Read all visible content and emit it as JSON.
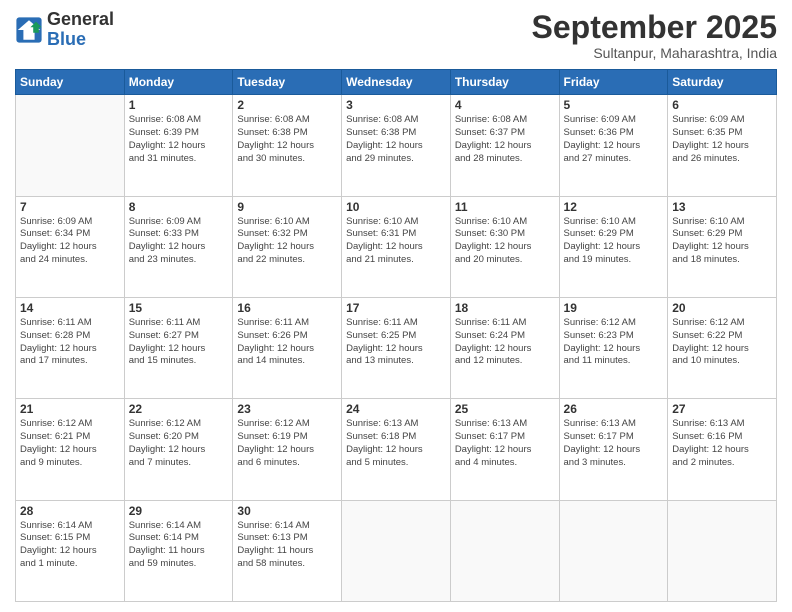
{
  "logo": {
    "line1": "General",
    "line2": "Blue"
  },
  "title": "September 2025",
  "subtitle": "Sultanpur, Maharashtra, India",
  "days_of_week": [
    "Sunday",
    "Monday",
    "Tuesday",
    "Wednesday",
    "Thursday",
    "Friday",
    "Saturday"
  ],
  "weeks": [
    [
      {
        "day": "",
        "info": ""
      },
      {
        "day": "1",
        "info": "Sunrise: 6:08 AM\nSunset: 6:39 PM\nDaylight: 12 hours\nand 31 minutes."
      },
      {
        "day": "2",
        "info": "Sunrise: 6:08 AM\nSunset: 6:38 PM\nDaylight: 12 hours\nand 30 minutes."
      },
      {
        "day": "3",
        "info": "Sunrise: 6:08 AM\nSunset: 6:38 PM\nDaylight: 12 hours\nand 29 minutes."
      },
      {
        "day": "4",
        "info": "Sunrise: 6:08 AM\nSunset: 6:37 PM\nDaylight: 12 hours\nand 28 minutes."
      },
      {
        "day": "5",
        "info": "Sunrise: 6:09 AM\nSunset: 6:36 PM\nDaylight: 12 hours\nand 27 minutes."
      },
      {
        "day": "6",
        "info": "Sunrise: 6:09 AM\nSunset: 6:35 PM\nDaylight: 12 hours\nand 26 minutes."
      }
    ],
    [
      {
        "day": "7",
        "info": "Sunrise: 6:09 AM\nSunset: 6:34 PM\nDaylight: 12 hours\nand 24 minutes."
      },
      {
        "day": "8",
        "info": "Sunrise: 6:09 AM\nSunset: 6:33 PM\nDaylight: 12 hours\nand 23 minutes."
      },
      {
        "day": "9",
        "info": "Sunrise: 6:10 AM\nSunset: 6:32 PM\nDaylight: 12 hours\nand 22 minutes."
      },
      {
        "day": "10",
        "info": "Sunrise: 6:10 AM\nSunset: 6:31 PM\nDaylight: 12 hours\nand 21 minutes."
      },
      {
        "day": "11",
        "info": "Sunrise: 6:10 AM\nSunset: 6:30 PM\nDaylight: 12 hours\nand 20 minutes."
      },
      {
        "day": "12",
        "info": "Sunrise: 6:10 AM\nSunset: 6:29 PM\nDaylight: 12 hours\nand 19 minutes."
      },
      {
        "day": "13",
        "info": "Sunrise: 6:10 AM\nSunset: 6:29 PM\nDaylight: 12 hours\nand 18 minutes."
      }
    ],
    [
      {
        "day": "14",
        "info": "Sunrise: 6:11 AM\nSunset: 6:28 PM\nDaylight: 12 hours\nand 17 minutes."
      },
      {
        "day": "15",
        "info": "Sunrise: 6:11 AM\nSunset: 6:27 PM\nDaylight: 12 hours\nand 15 minutes."
      },
      {
        "day": "16",
        "info": "Sunrise: 6:11 AM\nSunset: 6:26 PM\nDaylight: 12 hours\nand 14 minutes."
      },
      {
        "day": "17",
        "info": "Sunrise: 6:11 AM\nSunset: 6:25 PM\nDaylight: 12 hours\nand 13 minutes."
      },
      {
        "day": "18",
        "info": "Sunrise: 6:11 AM\nSunset: 6:24 PM\nDaylight: 12 hours\nand 12 minutes."
      },
      {
        "day": "19",
        "info": "Sunrise: 6:12 AM\nSunset: 6:23 PM\nDaylight: 12 hours\nand 11 minutes."
      },
      {
        "day": "20",
        "info": "Sunrise: 6:12 AM\nSunset: 6:22 PM\nDaylight: 12 hours\nand 10 minutes."
      }
    ],
    [
      {
        "day": "21",
        "info": "Sunrise: 6:12 AM\nSunset: 6:21 PM\nDaylight: 12 hours\nand 9 minutes."
      },
      {
        "day": "22",
        "info": "Sunrise: 6:12 AM\nSunset: 6:20 PM\nDaylight: 12 hours\nand 7 minutes."
      },
      {
        "day": "23",
        "info": "Sunrise: 6:12 AM\nSunset: 6:19 PM\nDaylight: 12 hours\nand 6 minutes."
      },
      {
        "day": "24",
        "info": "Sunrise: 6:13 AM\nSunset: 6:18 PM\nDaylight: 12 hours\nand 5 minutes."
      },
      {
        "day": "25",
        "info": "Sunrise: 6:13 AM\nSunset: 6:17 PM\nDaylight: 12 hours\nand 4 minutes."
      },
      {
        "day": "26",
        "info": "Sunrise: 6:13 AM\nSunset: 6:17 PM\nDaylight: 12 hours\nand 3 minutes."
      },
      {
        "day": "27",
        "info": "Sunrise: 6:13 AM\nSunset: 6:16 PM\nDaylight: 12 hours\nand 2 minutes."
      }
    ],
    [
      {
        "day": "28",
        "info": "Sunrise: 6:14 AM\nSunset: 6:15 PM\nDaylight: 12 hours\nand 1 minute."
      },
      {
        "day": "29",
        "info": "Sunrise: 6:14 AM\nSunset: 6:14 PM\nDaylight: 11 hours\nand 59 minutes."
      },
      {
        "day": "30",
        "info": "Sunrise: 6:14 AM\nSunset: 6:13 PM\nDaylight: 11 hours\nand 58 minutes."
      },
      {
        "day": "",
        "info": ""
      },
      {
        "day": "",
        "info": ""
      },
      {
        "day": "",
        "info": ""
      },
      {
        "day": "",
        "info": ""
      }
    ]
  ]
}
